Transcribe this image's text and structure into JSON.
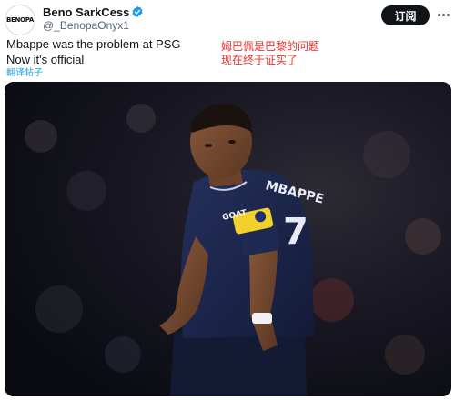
{
  "author": {
    "display_name": "Beno SarkCess",
    "handle": "@_BenopaOnyx1",
    "avatar_text": "BENOPA",
    "verified": true
  },
  "actions": {
    "follow_label": "订阅",
    "more_icon": "more-horizontal-icon"
  },
  "tweet": {
    "text_lines": [
      "Mbappe was the problem at PSG",
      "Now it's official"
    ],
    "translate_label": "翻译帖子"
  },
  "overlay_caption": {
    "lines": [
      "姆巴佩是巴黎的问题",
      "现在终于证实了"
    ],
    "color": "#e8322a"
  },
  "photo": {
    "jersey_name": "MBAPPE",
    "jersey_number": "7",
    "armband_text": "GOAT"
  },
  "colors": {
    "accent": "#1d9bf0",
    "verified_badge": "#1d9bf0",
    "follow_button_bg": "#0f1419",
    "jersey": "#1a2348",
    "armband": "#f2d12b"
  }
}
